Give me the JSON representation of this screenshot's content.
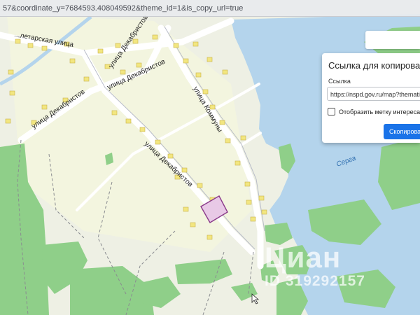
{
  "browser": {
    "url_fragment": "57&coordinate_y=7684593.408049592&theme_id=1&is_copy_url=true"
  },
  "map": {
    "colors": {
      "background": "#eef0e4",
      "water": "#b4d4ec",
      "forest": "#8fcf89",
      "road": "#ffffff",
      "building": "#f2e680",
      "parcel_fill": "#e8c9e6",
      "parcel_stroke": "#8a3a8a"
    },
    "streets": [
      {
        "id": "street-proletarskaya",
        "label": "...летарская улица"
      },
      {
        "id": "street-dekabristov-1",
        "label": "улица Декабристов"
      },
      {
        "id": "street-dekabristov-2",
        "label": "улица Декабристов"
      },
      {
        "id": "street-dekabristov-3",
        "label": "улица Декабристов"
      },
      {
        "id": "street-dekabristov-4",
        "label": "улица Декабристов"
      },
      {
        "id": "street-kommuny",
        "label": "улица Коммуны"
      }
    ],
    "water_label": "Серга"
  },
  "share_panel": {
    "title": "Ссылка для копирования",
    "link_label": "Ссылка",
    "link_value": "https://nspd.gov.ru/map?thematic=PK",
    "checkbox_label": "Отобразить метку интереса",
    "copy_button": "Скопировать"
  },
  "watermark": {
    "logo": "Циан",
    "id": "ID 319292157"
  }
}
